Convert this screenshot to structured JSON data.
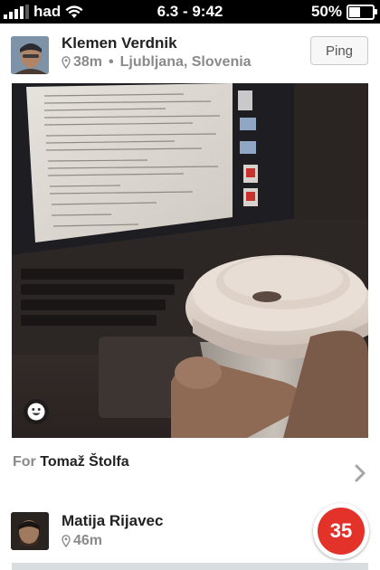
{
  "status_bar": {
    "carrier": "had",
    "time": "6.3 - 9:42",
    "battery": "50%",
    "battery_level": 0.5,
    "signal_bars": 4
  },
  "post": {
    "user_name": "Klemen Verdnik",
    "distance": "38m",
    "separator": "•",
    "location": "Ljubljana, Slovenia",
    "ping_label": "Ping",
    "for_label": "For",
    "for_name": "Tomaž Štolfa"
  },
  "next_post": {
    "user_name": "Matija Rijavec",
    "distance": "46m",
    "badge_count": "35"
  },
  "colors": {
    "badge_red": "#e2322a",
    "meta_gray": "#8a8a8a"
  },
  "icons": {
    "location": "map-pin-icon",
    "emoji": "smiley-icon",
    "disclosure": "chevron-right-icon"
  }
}
